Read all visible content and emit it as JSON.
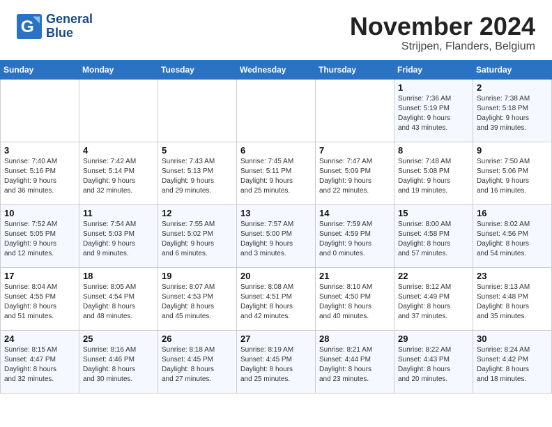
{
  "header": {
    "logo_line1": "General",
    "logo_line2": "Blue",
    "month": "November 2024",
    "location": "Strijpen, Flanders, Belgium"
  },
  "weekdays": [
    "Sunday",
    "Monday",
    "Tuesday",
    "Wednesday",
    "Thursday",
    "Friday",
    "Saturday"
  ],
  "weeks": [
    [
      {
        "day": "",
        "info": ""
      },
      {
        "day": "",
        "info": ""
      },
      {
        "day": "",
        "info": ""
      },
      {
        "day": "",
        "info": ""
      },
      {
        "day": "",
        "info": ""
      },
      {
        "day": "1",
        "info": "Sunrise: 7:36 AM\nSunset: 5:19 PM\nDaylight: 9 hours\nand 43 minutes."
      },
      {
        "day": "2",
        "info": "Sunrise: 7:38 AM\nSunset: 5:18 PM\nDaylight: 9 hours\nand 39 minutes."
      }
    ],
    [
      {
        "day": "3",
        "info": "Sunrise: 7:40 AM\nSunset: 5:16 PM\nDaylight: 9 hours\nand 36 minutes."
      },
      {
        "day": "4",
        "info": "Sunrise: 7:42 AM\nSunset: 5:14 PM\nDaylight: 9 hours\nand 32 minutes."
      },
      {
        "day": "5",
        "info": "Sunrise: 7:43 AM\nSunset: 5:13 PM\nDaylight: 9 hours\nand 29 minutes."
      },
      {
        "day": "6",
        "info": "Sunrise: 7:45 AM\nSunset: 5:11 PM\nDaylight: 9 hours\nand 25 minutes."
      },
      {
        "day": "7",
        "info": "Sunrise: 7:47 AM\nSunset: 5:09 PM\nDaylight: 9 hours\nand 22 minutes."
      },
      {
        "day": "8",
        "info": "Sunrise: 7:48 AM\nSunset: 5:08 PM\nDaylight: 9 hours\nand 19 minutes."
      },
      {
        "day": "9",
        "info": "Sunrise: 7:50 AM\nSunset: 5:06 PM\nDaylight: 9 hours\nand 16 minutes."
      }
    ],
    [
      {
        "day": "10",
        "info": "Sunrise: 7:52 AM\nSunset: 5:05 PM\nDaylight: 9 hours\nand 12 minutes."
      },
      {
        "day": "11",
        "info": "Sunrise: 7:54 AM\nSunset: 5:03 PM\nDaylight: 9 hours\nand 9 minutes."
      },
      {
        "day": "12",
        "info": "Sunrise: 7:55 AM\nSunset: 5:02 PM\nDaylight: 9 hours\nand 6 minutes."
      },
      {
        "day": "13",
        "info": "Sunrise: 7:57 AM\nSunset: 5:00 PM\nDaylight: 9 hours\nand 3 minutes."
      },
      {
        "day": "14",
        "info": "Sunrise: 7:59 AM\nSunset: 4:59 PM\nDaylight: 9 hours\nand 0 minutes."
      },
      {
        "day": "15",
        "info": "Sunrise: 8:00 AM\nSunset: 4:58 PM\nDaylight: 8 hours\nand 57 minutes."
      },
      {
        "day": "16",
        "info": "Sunrise: 8:02 AM\nSunset: 4:56 PM\nDaylight: 8 hours\nand 54 minutes."
      }
    ],
    [
      {
        "day": "17",
        "info": "Sunrise: 8:04 AM\nSunset: 4:55 PM\nDaylight: 8 hours\nand 51 minutes."
      },
      {
        "day": "18",
        "info": "Sunrise: 8:05 AM\nSunset: 4:54 PM\nDaylight: 8 hours\nand 48 minutes."
      },
      {
        "day": "19",
        "info": "Sunrise: 8:07 AM\nSunset: 4:53 PM\nDaylight: 8 hours\nand 45 minutes."
      },
      {
        "day": "20",
        "info": "Sunrise: 8:08 AM\nSunset: 4:51 PM\nDaylight: 8 hours\nand 42 minutes."
      },
      {
        "day": "21",
        "info": "Sunrise: 8:10 AM\nSunset: 4:50 PM\nDaylight: 8 hours\nand 40 minutes."
      },
      {
        "day": "22",
        "info": "Sunrise: 8:12 AM\nSunset: 4:49 PM\nDaylight: 8 hours\nand 37 minutes."
      },
      {
        "day": "23",
        "info": "Sunrise: 8:13 AM\nSunset: 4:48 PM\nDaylight: 8 hours\nand 35 minutes."
      }
    ],
    [
      {
        "day": "24",
        "info": "Sunrise: 8:15 AM\nSunset: 4:47 PM\nDaylight: 8 hours\nand 32 minutes."
      },
      {
        "day": "25",
        "info": "Sunrise: 8:16 AM\nSunset: 4:46 PM\nDaylight: 8 hours\nand 30 minutes."
      },
      {
        "day": "26",
        "info": "Sunrise: 8:18 AM\nSunset: 4:45 PM\nDaylight: 8 hours\nand 27 minutes."
      },
      {
        "day": "27",
        "info": "Sunrise: 8:19 AM\nSunset: 4:45 PM\nDaylight: 8 hours\nand 25 minutes."
      },
      {
        "day": "28",
        "info": "Sunrise: 8:21 AM\nSunset: 4:44 PM\nDaylight: 8 hours\nand 23 minutes."
      },
      {
        "day": "29",
        "info": "Sunrise: 8:22 AM\nSunset: 4:43 PM\nDaylight: 8 hours\nand 20 minutes."
      },
      {
        "day": "30",
        "info": "Sunrise: 8:24 AM\nSunset: 4:42 PM\nDaylight: 8 hours\nand 18 minutes."
      }
    ]
  ]
}
